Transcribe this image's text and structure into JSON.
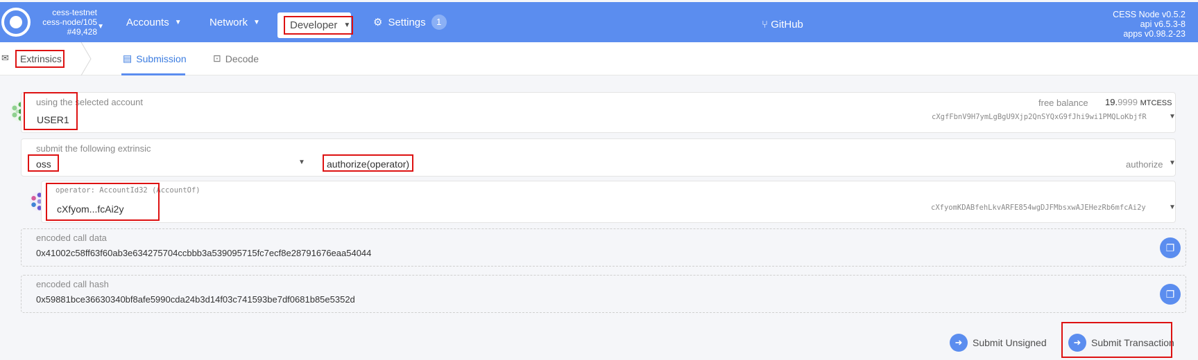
{
  "header": {
    "chain_name": "cess-testnet",
    "node": "cess-node/105",
    "block": "#49,428",
    "nav": {
      "accounts": "Accounts",
      "network": "Network",
      "developer": "Developer",
      "settings": "Settings",
      "settings_badge": "1",
      "github": "GitHub"
    },
    "version": {
      "node": "CESS Node v0.5.2",
      "api": "api v6.5.3-8",
      "apps": "apps v0.98.2-23"
    }
  },
  "subnav": {
    "section": "Extrinsics",
    "tabs": {
      "submission": "Submission",
      "decode": "Decode"
    }
  },
  "account": {
    "label": "using the selected account",
    "name": "USER1",
    "balance_label": "free balance",
    "balance_int": "19.",
    "balance_dec": "9999",
    "balance_unit": "MTCESS",
    "address": "cXgfFbnV9H7ymLgBgU9Xjp2QnSYQxG9fJhi9wi1PMQLoKbjfR"
  },
  "extrinsic": {
    "label": "submit the following extrinsic",
    "pallet": "oss",
    "call": "authorize(operator)",
    "call_name": "authorize"
  },
  "param": {
    "label": "operator: AccountId32",
    "type": "(AccountOf)",
    "value": "cXfyom...fcAi2y",
    "address": "cXfyomKDABfehLkvARFE854wgDJFMbsxwAJEHezRb6mfcAi2y"
  },
  "encoded": {
    "data_label": "encoded call data",
    "data": "0x41002c58ff63f60ab3e634275704ccbbb3a539095715fc7ecf8e28791676eaa54044",
    "hash_label": "encoded call hash",
    "hash": "0x59881bce36630340bf8afe5990cda24b3d14f03c741593be7df0681b85e5352d"
  },
  "actions": {
    "unsigned": "Submit Unsigned",
    "transaction": "Submit Transaction"
  },
  "colors": {
    "header": "#5b8def",
    "highlight": "#dd1111"
  }
}
